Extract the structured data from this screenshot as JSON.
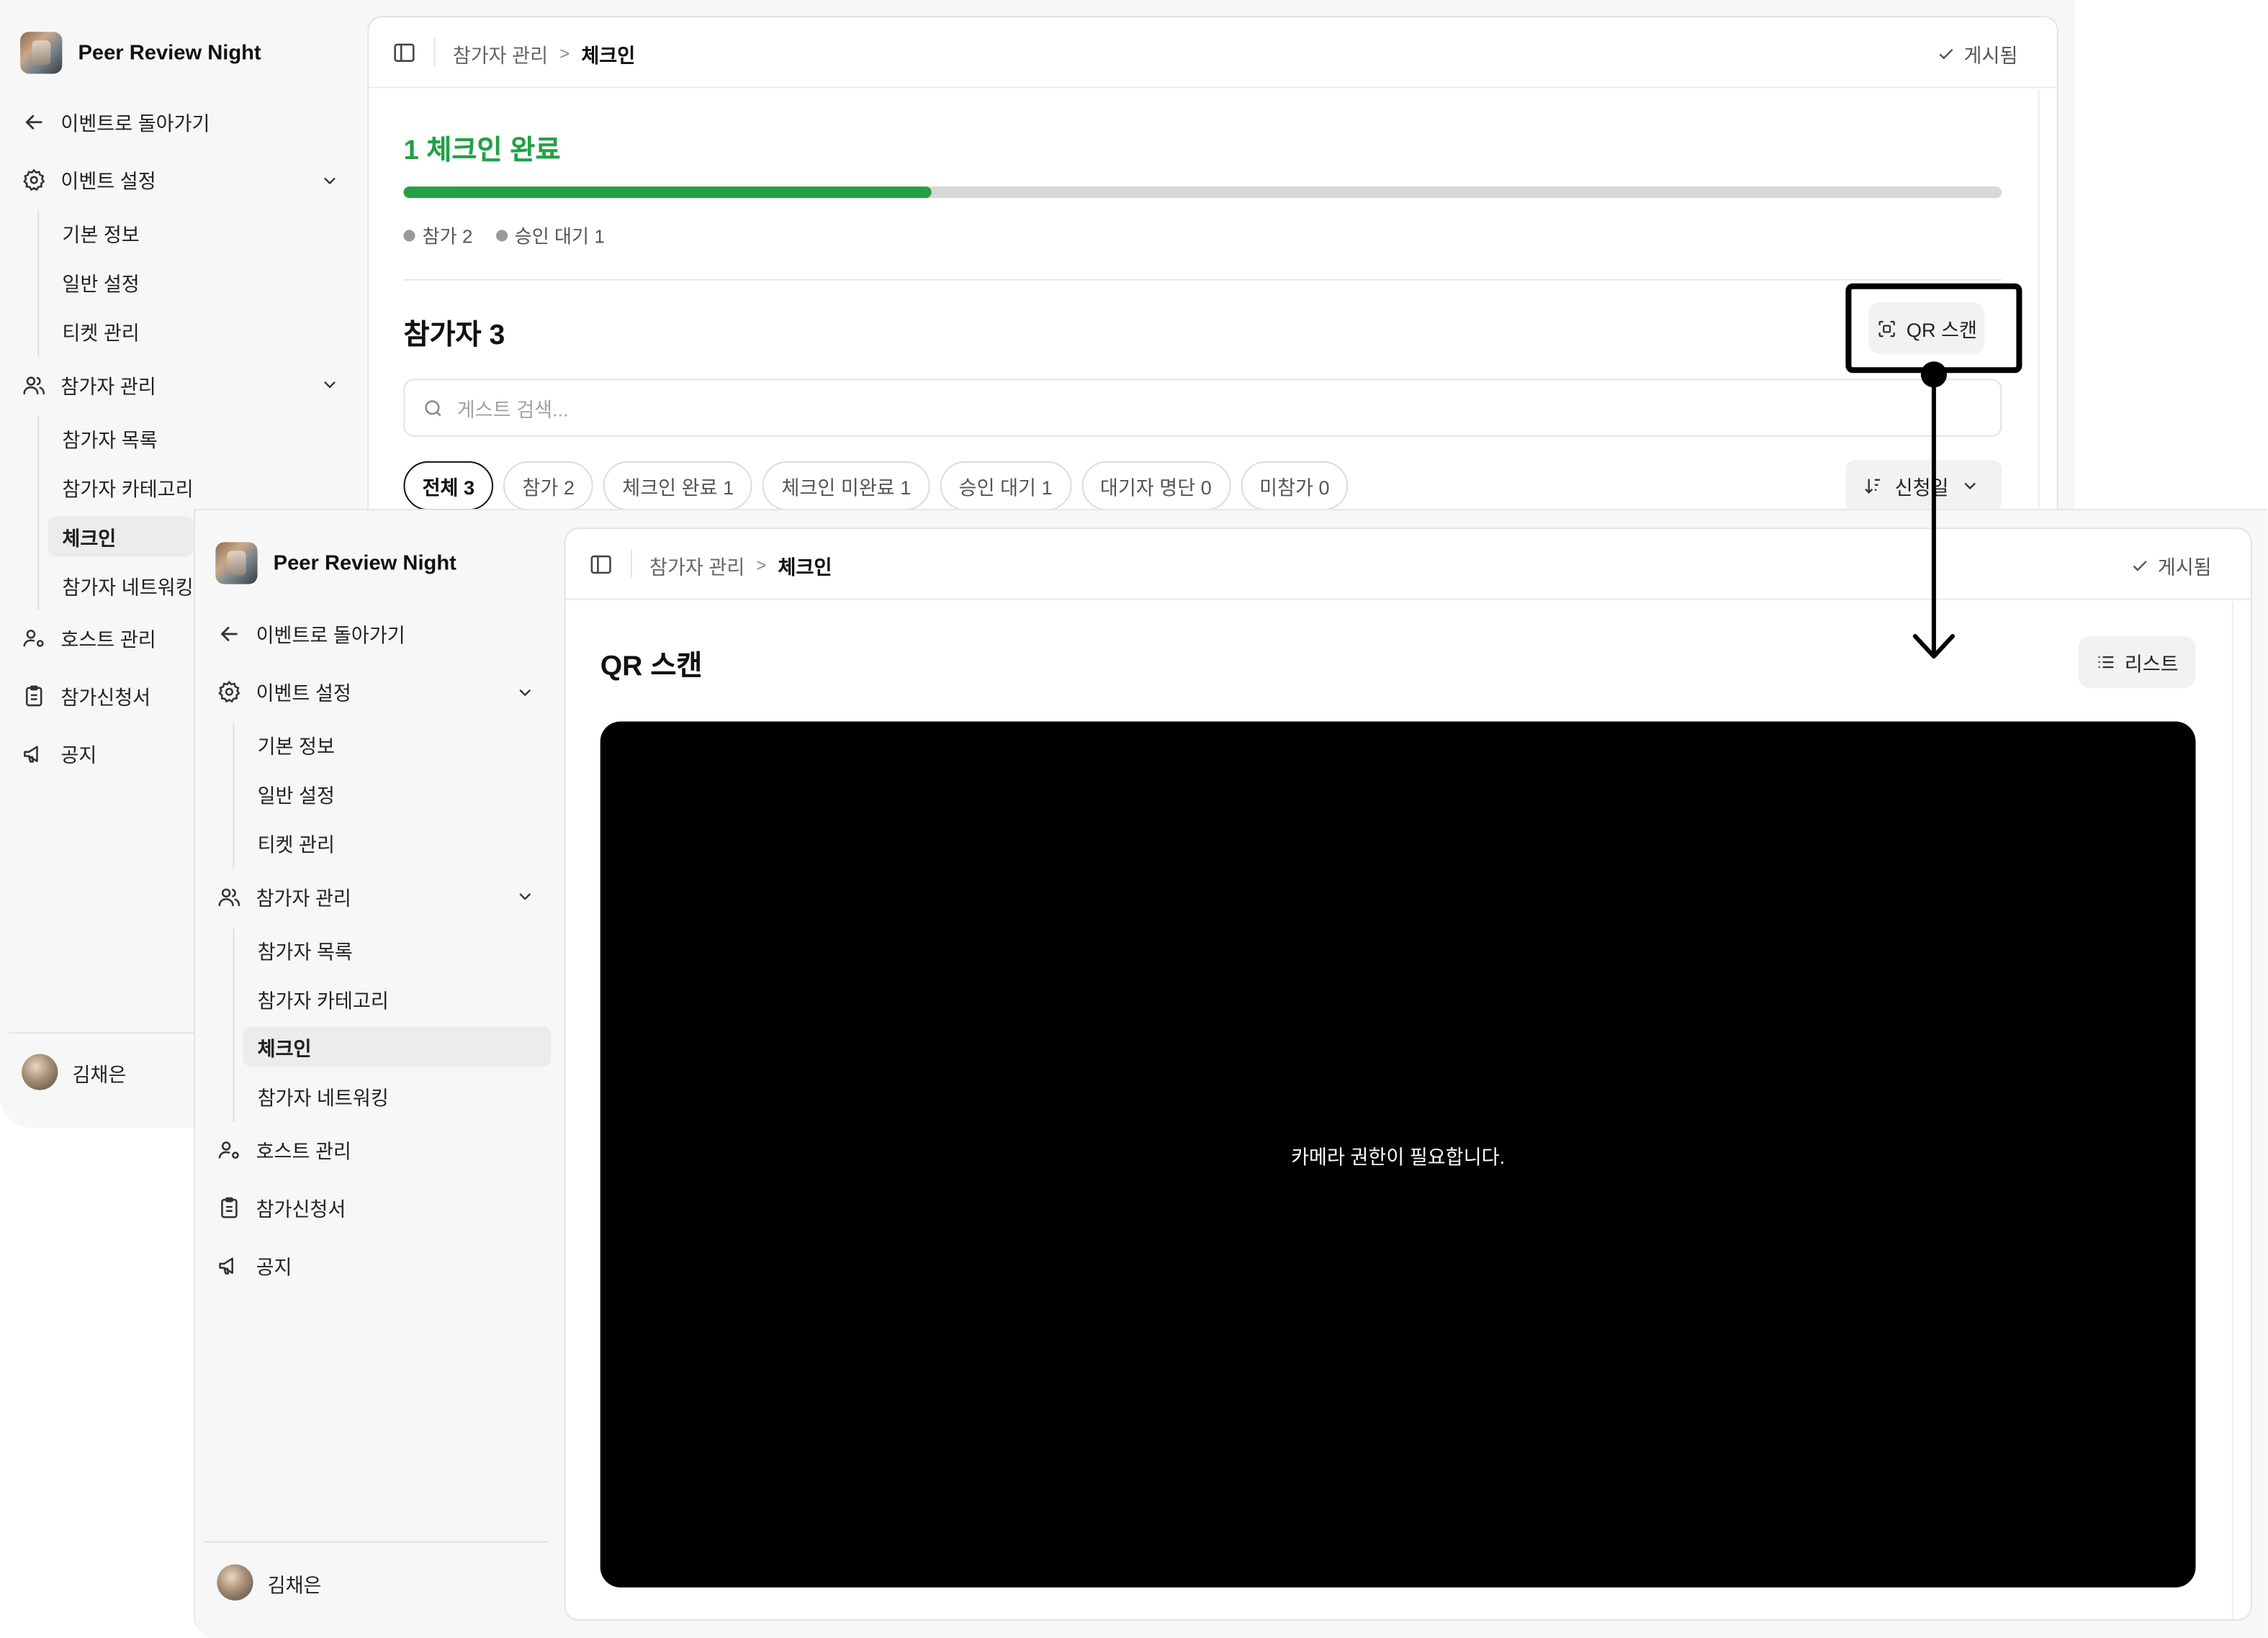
{
  "app": {
    "event_name": "Peer Review Night",
    "back_label": "이벤트로 돌아가기"
  },
  "sidebar": {
    "event_settings": {
      "label": "이벤트 설정",
      "items": [
        "기본 정보",
        "일반 설정",
        "티켓 관리"
      ]
    },
    "participant_mgmt": {
      "label": "참가자 관리",
      "items": [
        "참가자 목록",
        "참가자 카테고리",
        "체크인",
        "참가자 네트워킹"
      ]
    },
    "host_mgmt": "호스트 관리",
    "application_form": "참가신청서",
    "notice": "공지",
    "user_name": "김채은"
  },
  "header": {
    "crumb_parent": "참가자 관리",
    "crumb_current": "체크인",
    "status": "게시됨"
  },
  "checkin": {
    "done_title": "1 체크인 완료",
    "progress": 0.33,
    "legend": [
      "참가 2",
      "승인 대기 1"
    ],
    "count_title": "참가자 3",
    "qr_button": "QR 스캔",
    "search_placeholder": "게스트 검색...",
    "filters": [
      "전체 3",
      "참가 2",
      "체크인 완료 1",
      "체크인 미완료 1",
      "승인 대기 1",
      "대기자 명단 0",
      "미참가 0"
    ],
    "sort_label": "신청일"
  },
  "qr_scan": {
    "title": "QR 스캔",
    "list_button": "리스트",
    "camera_message": "카메라 권한이 필요합니다."
  },
  "colors": {
    "accent_green": "#22a046",
    "sidebar_bg": "#f7f7f7",
    "camera_bg": "#000000"
  }
}
